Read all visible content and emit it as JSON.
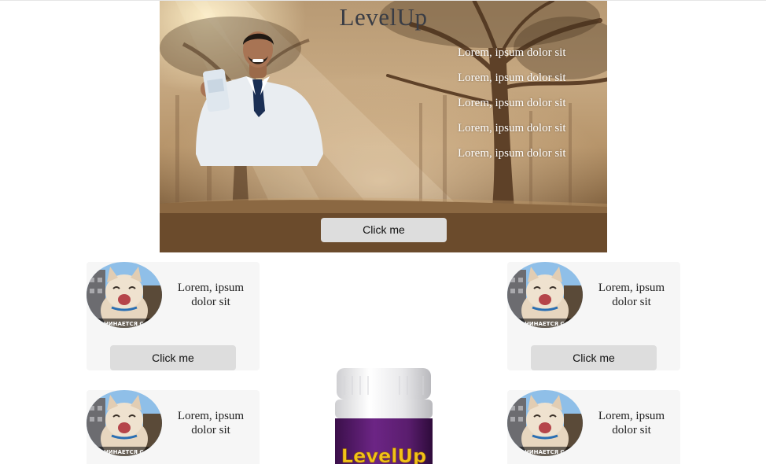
{
  "hero": {
    "title": "LevelUp",
    "list": [
      "Lorem, ipsum dolor sit",
      "Lorem, ipsum dolor sit",
      "Lorem, ipsum dolor sit",
      "Lorem, ipsum dolor sit",
      "Lorem, ipsum dolor sit"
    ],
    "button": "Click me"
  },
  "cards": [
    {
      "text": "Lorem, ipsum dolor sit",
      "button": "Click me"
    },
    {
      "text": "Lorem, ipsum dolor sit",
      "button": "Click me"
    },
    {
      "text": "Lorem, ipsum dolor sit"
    },
    {
      "text": "Lorem, ipsum dolor sit"
    }
  ],
  "product": {
    "label": "LevelUp"
  },
  "colors": {
    "card_bg": "#f6f6f6",
    "button_bg": "#dddddd",
    "jar_purple": "#5a1d6e",
    "label_yellow": "#f2c21a"
  }
}
